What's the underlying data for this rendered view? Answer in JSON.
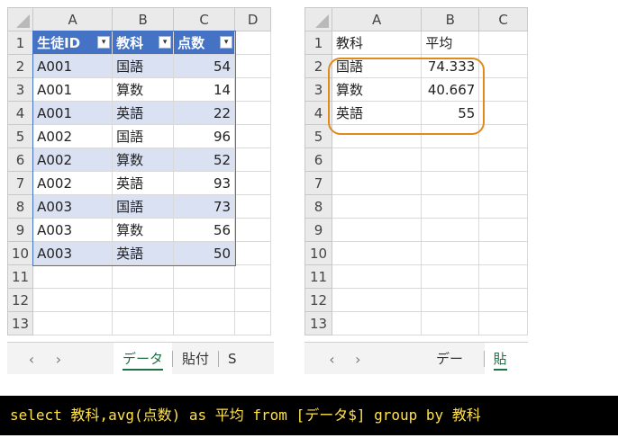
{
  "left_sheet": {
    "col_headers": [
      "A",
      "B",
      "C",
      "D"
    ],
    "row_numbers": [
      "1",
      "2",
      "3",
      "4",
      "5",
      "6",
      "7",
      "8",
      "9",
      "10",
      "11",
      "12",
      "13"
    ],
    "table_headers": [
      "生徒ID",
      "教科",
      "点数"
    ],
    "rows": [
      [
        "A001",
        "国語",
        "54"
      ],
      [
        "A001",
        "算数",
        "14"
      ],
      [
        "A001",
        "英語",
        "22"
      ],
      [
        "A002",
        "国語",
        "96"
      ],
      [
        "A002",
        "算数",
        "52"
      ],
      [
        "A002",
        "英語",
        "93"
      ],
      [
        "A003",
        "国語",
        "73"
      ],
      [
        "A003",
        "算数",
        "56"
      ],
      [
        "A003",
        "英語",
        "50"
      ]
    ],
    "tabs": [
      "データ",
      "貼付",
      "S"
    ],
    "active_tab": "データ"
  },
  "right_sheet": {
    "col_headers": [
      "A",
      "B",
      "C"
    ],
    "row_numbers": [
      "1",
      "2",
      "3",
      "4",
      "5",
      "6",
      "7",
      "8",
      "9",
      "10",
      "11",
      "12",
      "13"
    ],
    "headers": [
      "教科",
      "平均"
    ],
    "rows": [
      [
        "国語",
        "74.333"
      ],
      [
        "算数",
        "40.667"
      ],
      [
        "英語",
        "55"
      ]
    ],
    "tabs": [
      "データ",
      "貼付"
    ],
    "active_tab": "貼付"
  },
  "sql": "select 教科,avg(点数) as 平均 from [データ$]  group by 教科",
  "colors": {
    "table_header": "#4472c4",
    "band": "#d9e1f2",
    "highlight": "#e08a1e",
    "sql_text": "#ffe14a"
  }
}
